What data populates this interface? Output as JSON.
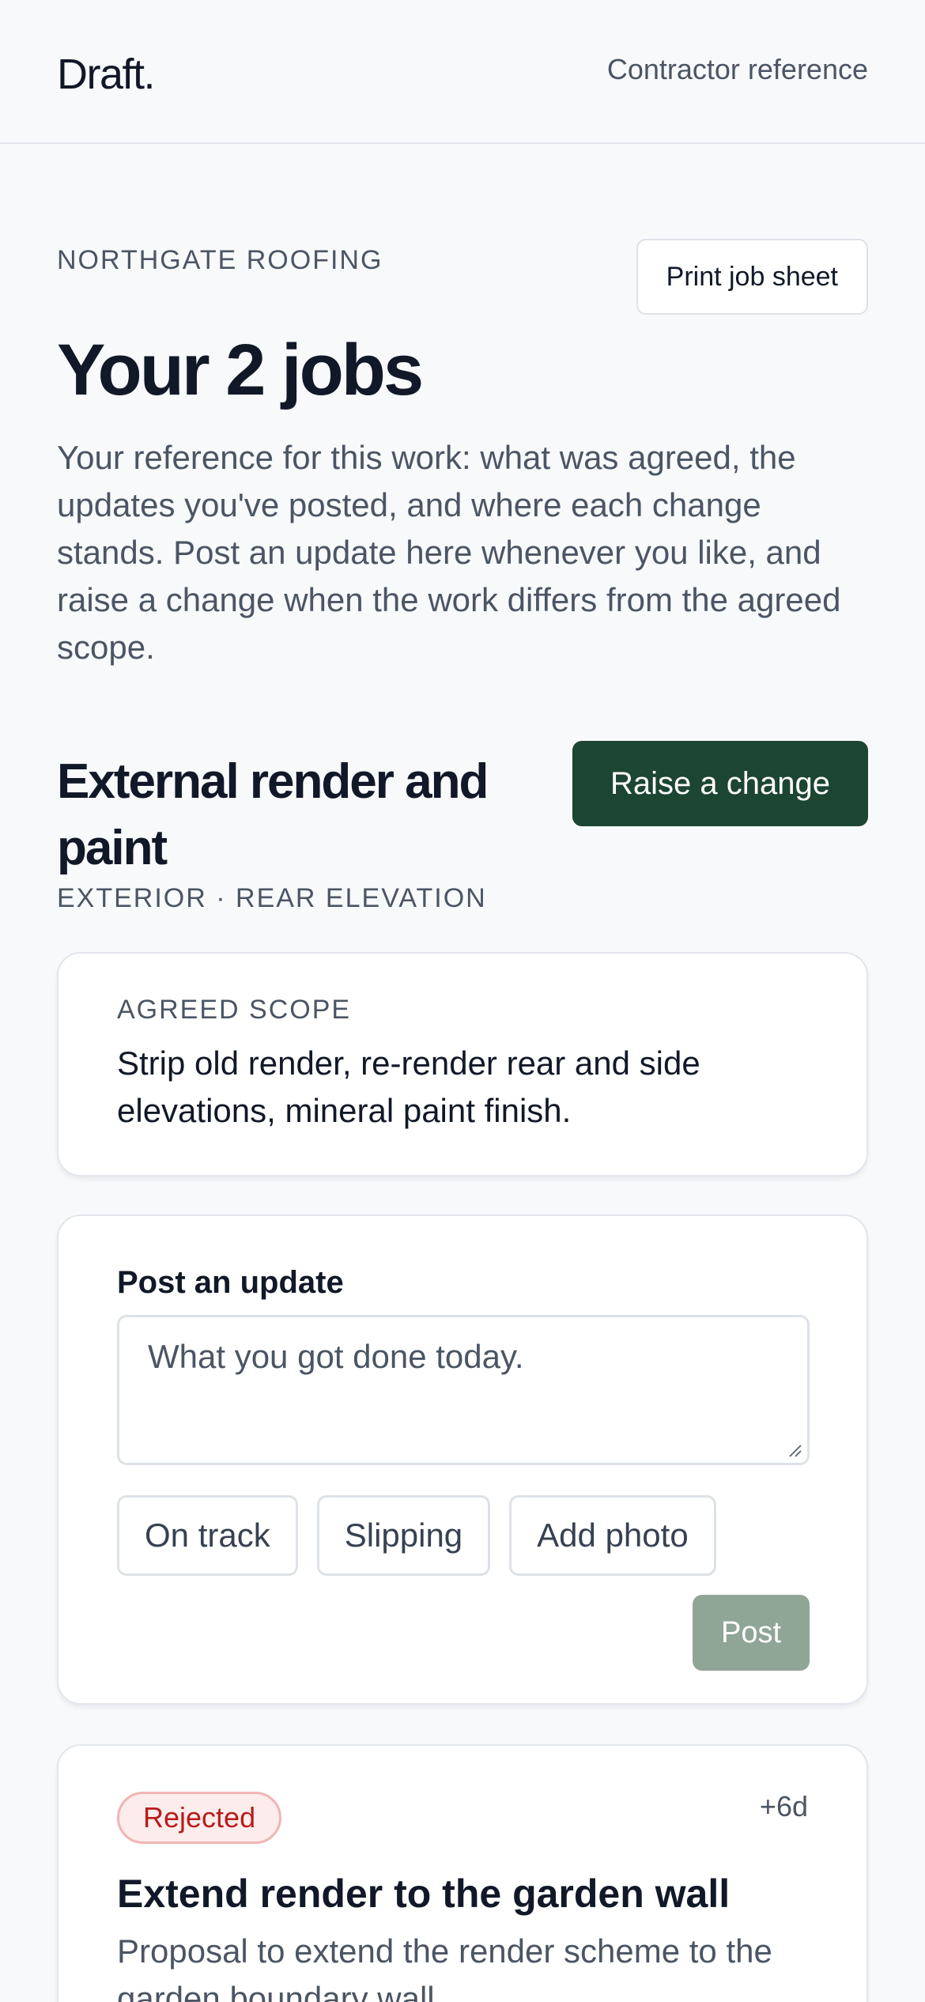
{
  "header": {
    "brand": "Draft.",
    "link_label": "Contractor reference"
  },
  "page": {
    "company": "NORTHGATE ROOFING",
    "print_label": "Print job sheet",
    "title": "Your 2 jobs",
    "intro": "Your reference for this work: what was agreed, the updates you've posted, and where each change stands. Post an update here whenever you like, and raise a change when the work differs from the agreed scope."
  },
  "job": {
    "title": "External render and paint",
    "meta": "EXTERIOR · REAR ELEVATION",
    "raise_label": "Raise a change",
    "scope": {
      "label": "AGREED SCOPE",
      "text": "Strip old render, re-render rear and side elevations, mineral paint finish."
    },
    "update": {
      "label": "Post an update",
      "placeholder": "What you got done today.",
      "chips": [
        "On track",
        "Slipping",
        "Add photo"
      ],
      "post_label": "Post"
    },
    "change": {
      "status": "Rejected",
      "age": "+6d",
      "title": "Extend render to the garden wall",
      "description": "Proposal to extend the render scheme to the garden boundary wall."
    }
  },
  "colors": {
    "primary": "#1c4532",
    "post_disabled": "#8fa596",
    "rejected_text": "#b91c1c",
    "rejected_bg": "#fdecec"
  }
}
